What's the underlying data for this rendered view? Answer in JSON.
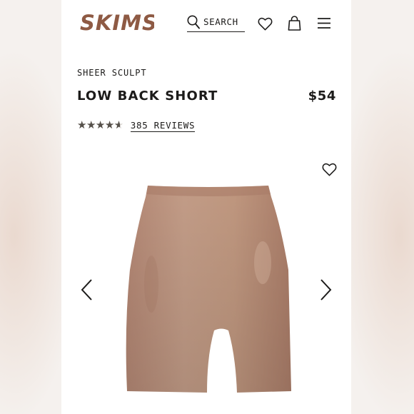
{
  "header": {
    "logo_text": "SKIMS",
    "search_label": "SEARCH",
    "icons": [
      "search-icon",
      "heart-icon",
      "bag-icon",
      "menu-icon"
    ]
  },
  "product": {
    "collection": "SHEER SCULPT",
    "name": "LOW BACK SHORT",
    "price": "$54",
    "rating": 4.6,
    "rating_max": 5,
    "reviews_label": "385 REVIEWS",
    "image_alt": "nude sheer shaping short",
    "color_hex": "#b98e78"
  },
  "gallery": {
    "prev_icon": "chevron-left-icon",
    "next_icon": "chevron-right-icon",
    "wishlist_icon": "heart-icon"
  },
  "colors": {
    "brand": "#8e5a44",
    "text": "#1c1b1a",
    "star": "#55504a"
  }
}
